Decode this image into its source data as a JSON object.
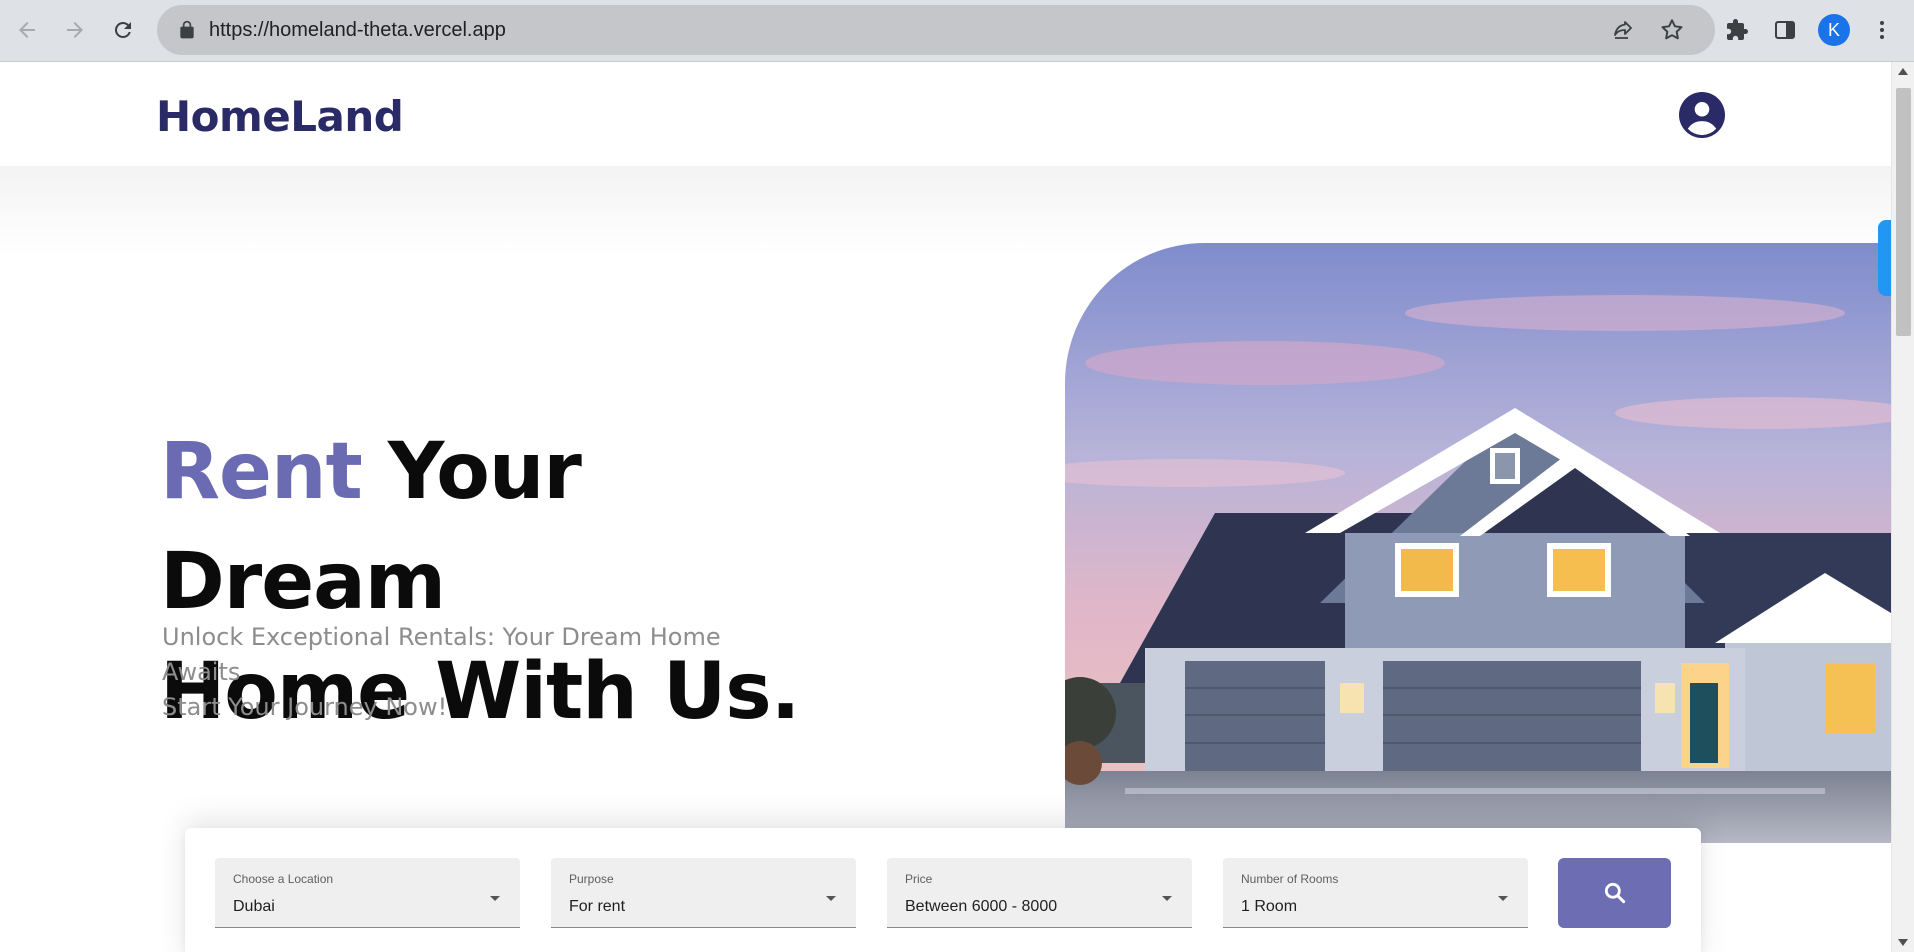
{
  "browser": {
    "url": "https://homeland-theta.vercel.app",
    "profile_initial": "K",
    "icons": [
      "back-arrow-icon",
      "forward-arrow-icon",
      "reload-icon",
      "lock-icon",
      "share-icon",
      "star-icon",
      "puzzle-icon",
      "side-panel-icon",
      "more-vert-icon"
    ]
  },
  "header": {
    "logo": "HomeLand",
    "account_icon": "account-circle-icon"
  },
  "hero": {
    "headline_accent": "Rent",
    "headline_rest_line1": " Your Dream",
    "headline_line2": "Home With Us.",
    "subtitle_line1": "Unlock Exceptional Rentals: Your Dream Home Awaits",
    "subtitle_line2": "Start Your Journey Now!"
  },
  "search": {
    "fields": [
      {
        "label": "Choose a Location",
        "value": "Dubai"
      },
      {
        "label": "Purpose",
        "value": "For rent"
      },
      {
        "label": "Price",
        "value": "Between 6000 - 8000"
      },
      {
        "label": "Number of Rooms",
        "value": "1 Room"
      }
    ],
    "button_icon": "search-icon"
  },
  "colors": {
    "brand_navy": "#2a2a66",
    "accent_purple": "#6b6bb3",
    "search_button": "#6d6db4",
    "side_tab_blue": "#2196f3"
  }
}
